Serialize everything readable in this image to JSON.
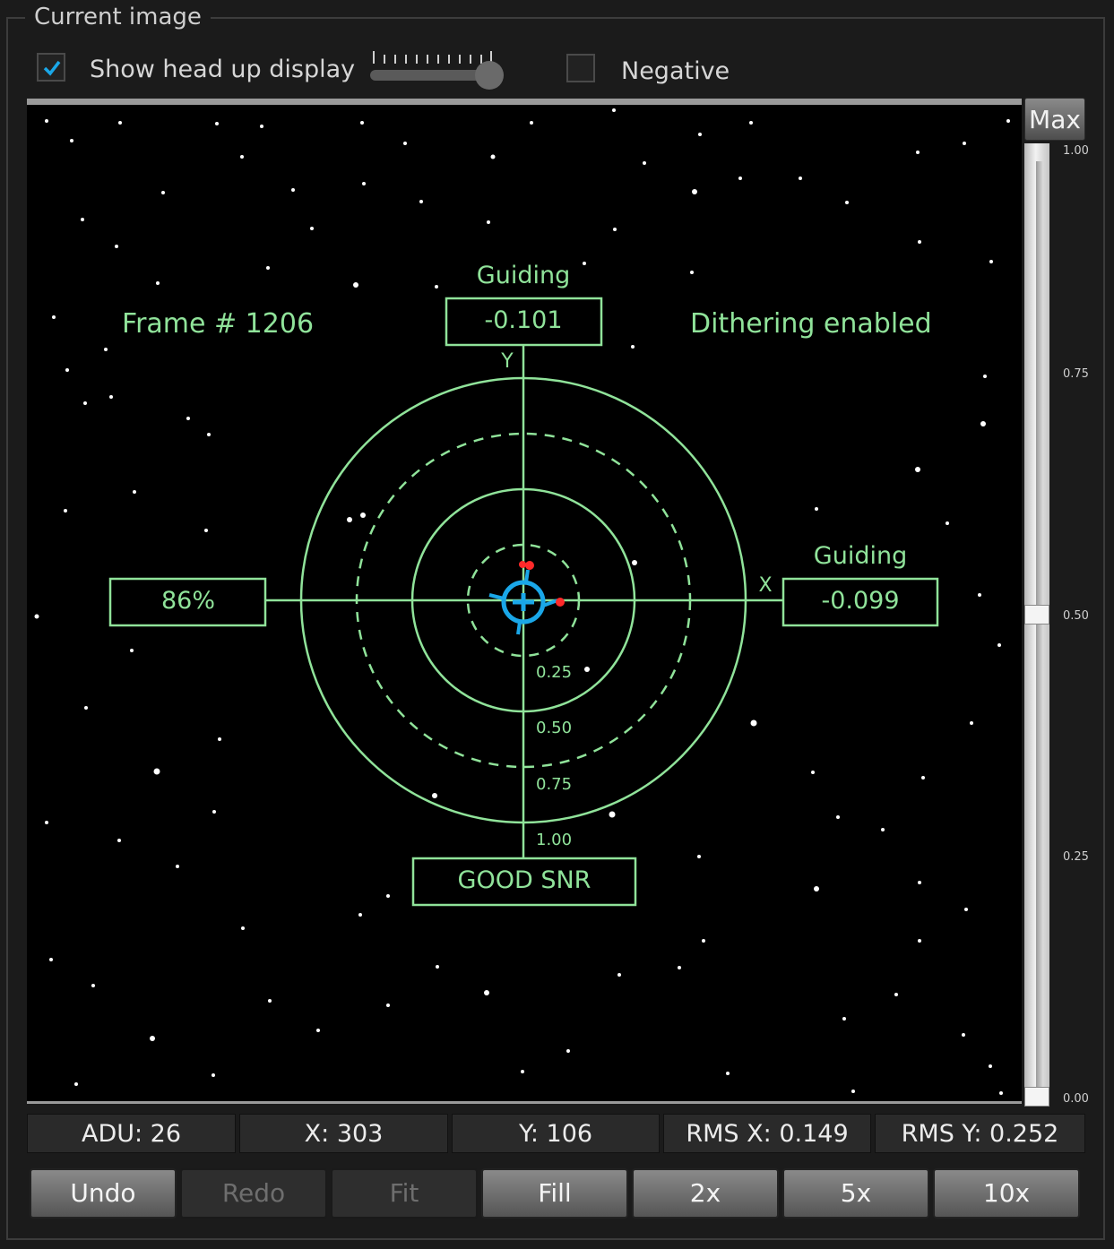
{
  "group": {
    "title": "Current image"
  },
  "options": {
    "hud_label": "Show head up display",
    "hud_checked": true,
    "negative_label": "Negative",
    "negative_checked": false
  },
  "hud": {
    "frame": "Frame # 1206",
    "dithering": "Dithering enabled",
    "top_status": "Guiding",
    "top_value": "-0.101",
    "right_status": "Guiding",
    "right_value": "-0.099",
    "left_value": "86%",
    "bottom_value": "GOOD SNR",
    "y_axis": "Y",
    "x_axis": "X",
    "rings": [
      "0.25",
      "0.50",
      "0.75",
      "1.00"
    ]
  },
  "stretch": {
    "max_label": "Max",
    "scale": [
      "1.00",
      "0.75",
      "0.50",
      "0.25",
      "0.00"
    ]
  },
  "status": {
    "adu": "ADU: 26",
    "x": "X: 303",
    "y": "Y: 106",
    "rms_x": "RMS X: 0.149",
    "rms_y": "RMS Y: 0.252"
  },
  "buttons": {
    "undo": "Undo",
    "redo": "Redo",
    "fit": "Fit",
    "fill": "Fill",
    "z2": "2x",
    "z5": "5x",
    "z10": "10x"
  },
  "colors": {
    "hud_green": "#90e39a",
    "crosshair_blue": "#1aa7e8",
    "star_red": "#ff2a2a"
  }
}
